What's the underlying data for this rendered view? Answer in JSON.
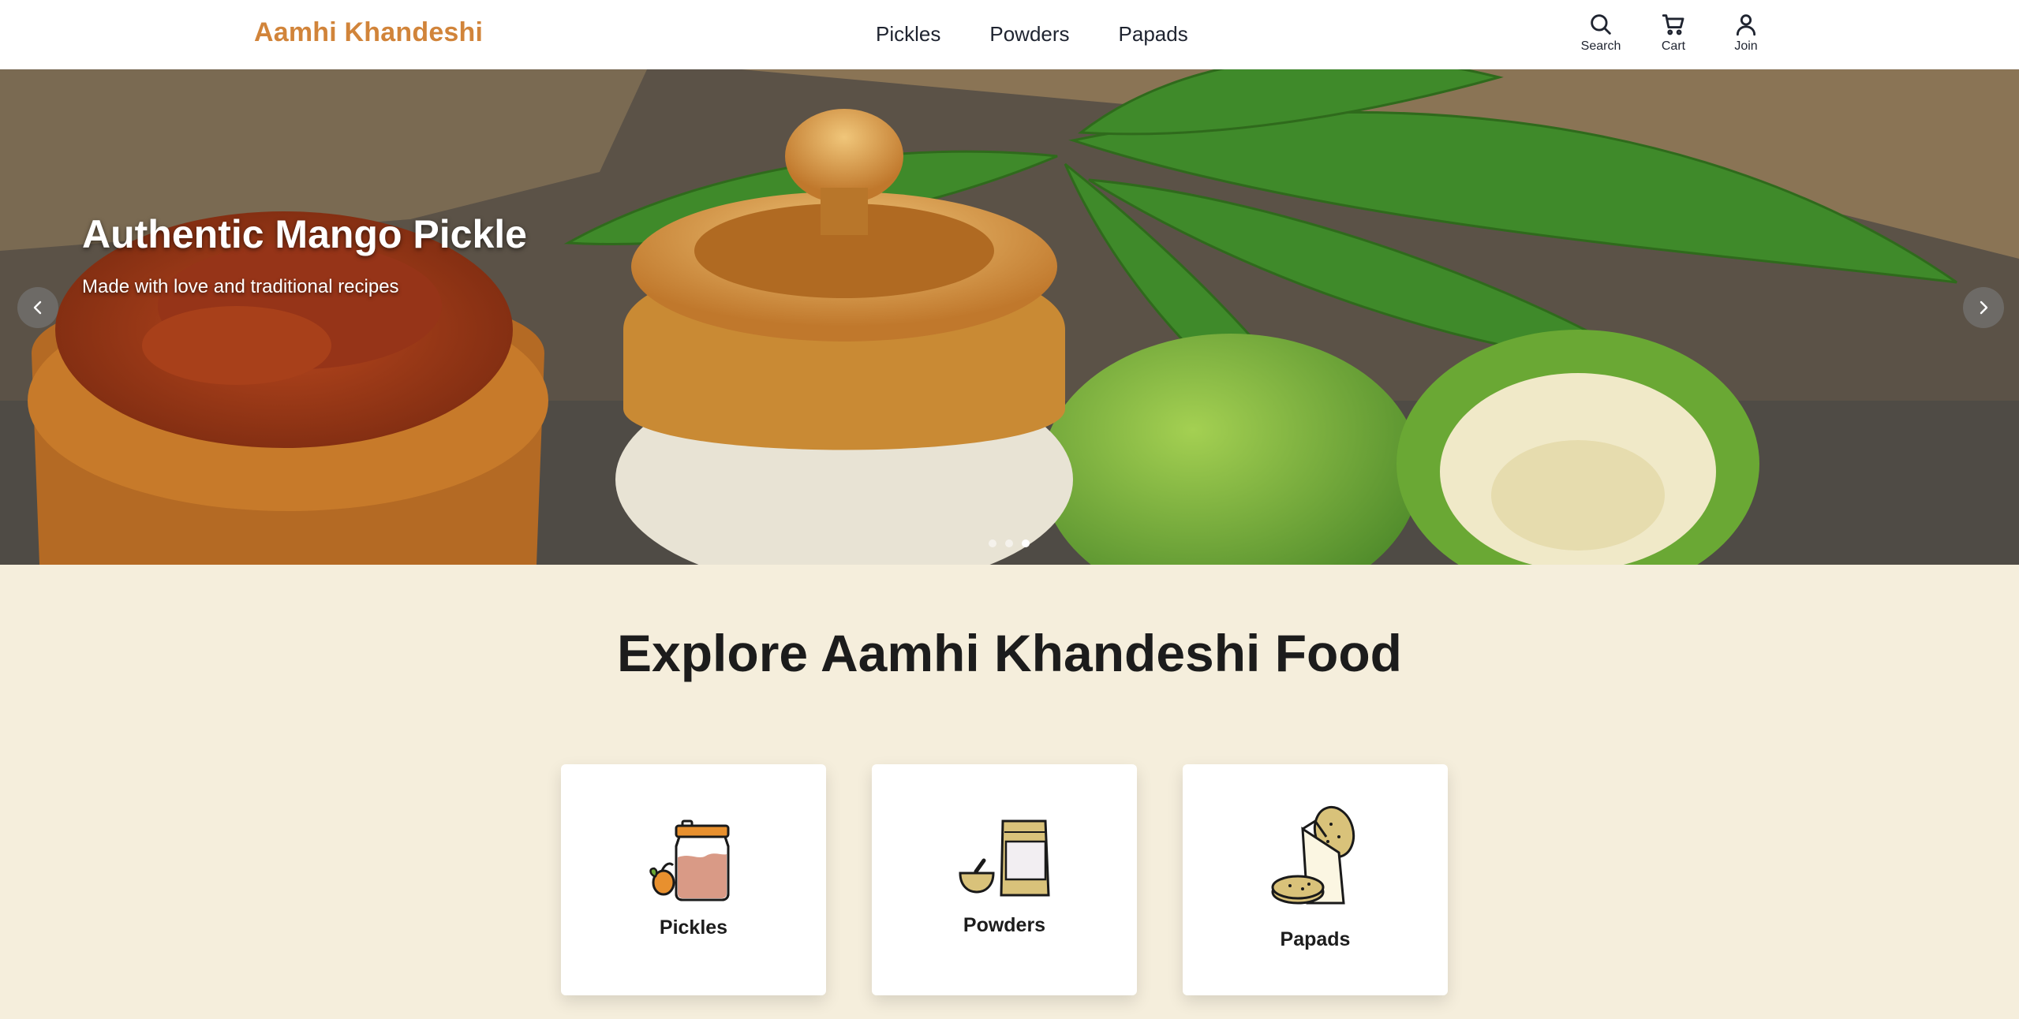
{
  "header": {
    "brand": "Aamhi Khandeshi",
    "nav": [
      "Pickles",
      "Powders",
      "Papads"
    ],
    "actions": {
      "search": "Search",
      "cart": "Cart",
      "join": "Join"
    }
  },
  "hero": {
    "title": "Authentic Mango Pickle",
    "subtitle": "Made with love and traditional recipes",
    "slide_count": 3,
    "active_slide": 3
  },
  "explore": {
    "title": "Explore Aamhi Khandeshi Food",
    "categories": [
      {
        "label": "Pickles",
        "icon": "pickle-jar-icon"
      },
      {
        "label": "Powders",
        "icon": "powder-packet-icon"
      },
      {
        "label": "Papads",
        "icon": "papad-icon"
      }
    ]
  },
  "colors": {
    "brand": "#d1843a",
    "page_bg": "#f5eedc",
    "card_bg": "#ffffff"
  }
}
